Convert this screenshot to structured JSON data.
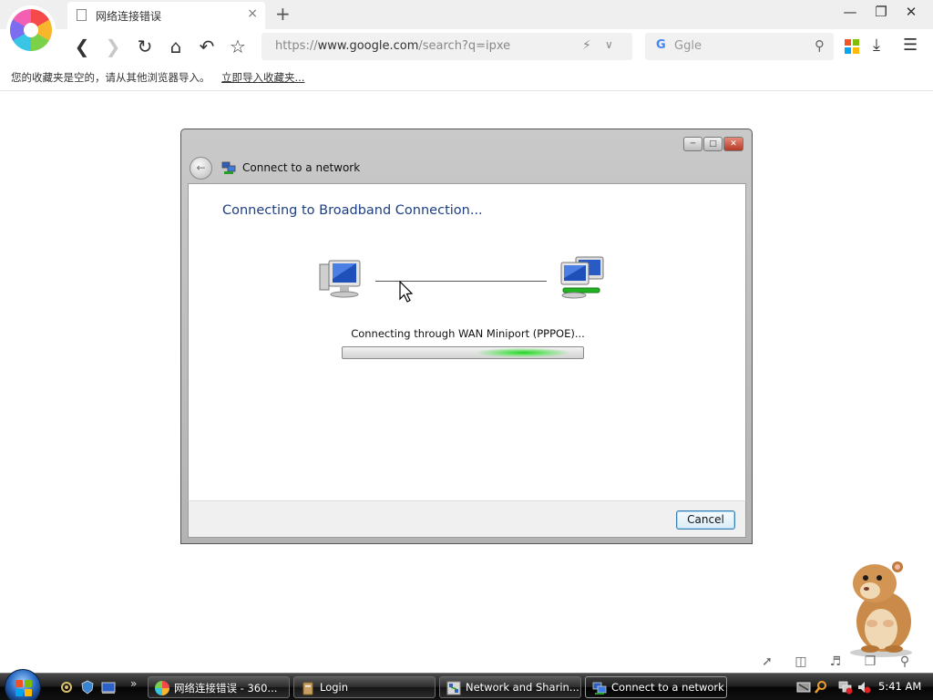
{
  "browser": {
    "tab_title": "网络连接错误",
    "tab_close": "×",
    "new_tab": "+",
    "url_prefix": "https://",
    "url_host": "www.google.com",
    "url_path": "/search?q=ipxe",
    "search_placeholder": "Ggle",
    "search_engine_glyph": "G",
    "bookmarks_notice": "您的收藏夹是空的，请从其他浏览器导入。",
    "bookmarks_import_link": "立即导入收藏夹...",
    "icons": [
      "logo-360",
      "page-icon",
      "back-icon",
      "forward-icon",
      "reload-icon",
      "home-icon",
      "undo-icon",
      "star-icon",
      "bolt-icon",
      "chevron-down-icon",
      "search-icon",
      "apps-grid-icon",
      "download-icon",
      "menu-icon",
      "minimize-icon",
      "restore-icon",
      "close-icon"
    ]
  },
  "dialog": {
    "title": "Connect to a network",
    "heading": "Connecting to Broadband Connection...",
    "status": "Connecting through WAN Miniport (PPPOE)...",
    "progress": {
      "fill_start": 0.56,
      "fill_end": 0.94
    },
    "cancel_label": "Cancel",
    "accent_color": "#1e3f82"
  },
  "status_icons": [
    "rocket-icon",
    "trash-icon",
    "speaker-icon",
    "window-icon",
    "search-icon"
  ],
  "taskbar": {
    "tasks": [
      {
        "label": "网络连接错误 - 360...",
        "icon": "browser-360-icon",
        "active": false
      },
      {
        "label": "Login",
        "icon": "login-icon",
        "active": false
      },
      {
        "label": "Network and Sharin...",
        "icon": "network-sharing-icon",
        "active": false
      },
      {
        "label": "Connect to a network",
        "icon": "connect-network-icon",
        "active": true
      }
    ],
    "quick_launch_overflow": "»",
    "clock": "5:41 AM"
  }
}
